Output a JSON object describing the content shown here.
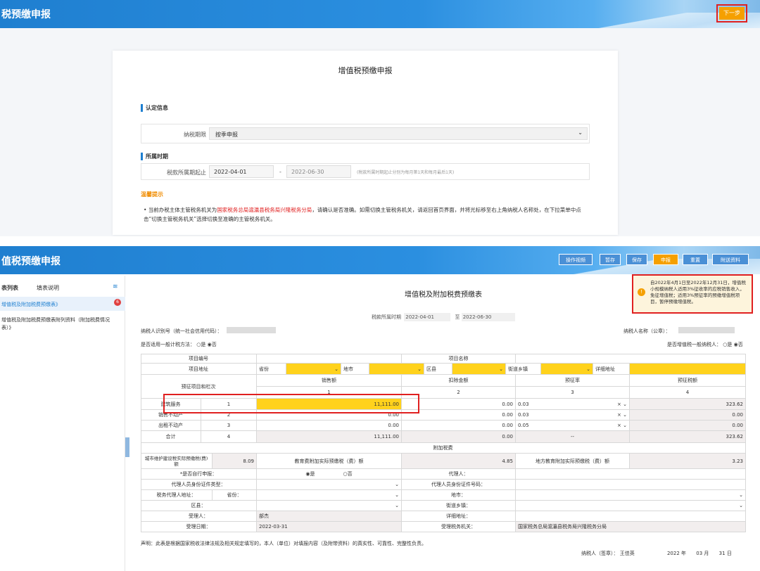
{
  "top": {
    "title": "税预缴申报",
    "next_button": "下一步",
    "card_title": "增值税预缴申报",
    "section1": "认定信息",
    "period_type_label": "纳税期限",
    "period_type_value": "按季申报",
    "section2": "所属时期",
    "period_label": "税款所属期起止",
    "date_from": "2022-04-01",
    "dash": "-",
    "date_to": "2022-06-30",
    "period_hint": "(税款所属时期起止分别为每月第1天和每月最后1天)",
    "tips_title": "温馨提示",
    "tip_pre": "当前办税主体主管税务机关为",
    "tip_red": "国家税务总局滬灜县税务局兴隆税务分局",
    "tip_post": "，请确认是否准确。如需切换主管税务机关，请返回首页界面，并将光标移至右上角纳税人名称处，在下拉菜单中点击“切换主管税务机关”选择切换至准确的主管税务机关。"
  },
  "bottom": {
    "title": "值税预缴申报",
    "buttons": [
      "操作视频",
      "暂存",
      "保存",
      "申报",
      "重置",
      "附送资料"
    ],
    "sidebar": {
      "tab1": "表列表",
      "tab2": "填表说明",
      "item1": "增值税及附加税费预缴表》",
      "item1_badge": "6",
      "item2": "增值税及附加税费预缴表附列资料（附加税费情况表）》"
    },
    "form_title": "增值税及附加税费预缴表",
    "period_label": "税款所属时期",
    "period_from": "2022-04-01",
    "period_to_label": "至",
    "period_to": "2022-06-30",
    "taxpayer_id_label": "纳税人识别号（统一社会信用代码）：",
    "taxpayer_name_label": "纳税人名称（公章）：",
    "general_method_label": "是否适用一般计税方法：",
    "general_yes": "是",
    "general_no": "否",
    "general_taxpayer_label": "是否增值税一般纳税人：",
    "notice": "自2022年4月1日至2022年12月31日，增值税小规模纳税人适用3%征收率的应税销售收入，免征增值税；适用3%预征率的预缴增值税项目，暂停预缴增值税。",
    "project_no": "项目编号",
    "project_name": "项目名称",
    "project_addr": "项目地址",
    "province": "省份",
    "city": "地市",
    "district": "区县",
    "street": "街道乡镇",
    "detail_addr": "详细地址",
    "col_item": "预征项目和栏次",
    "col_sales": "销售额",
    "col_deduct": "扣除金额",
    "col_rate": "预征率",
    "col_tax": "预征税额",
    "col_n1": "1",
    "col_n2": "2",
    "col_n3": "3",
    "col_n4": "4",
    "rows": [
      {
        "name": "建筑服务",
        "no": "1",
        "sales": "11,111.00",
        "deduct": "0.00",
        "rate": "0.03",
        "tax": "323.62"
      },
      {
        "name": "销售不动产",
        "no": "2",
        "sales": "0.00",
        "deduct": "0.00",
        "rate": "0.03",
        "tax": "0.00"
      },
      {
        "name": "出租不动产",
        "no": "3",
        "sales": "0.00",
        "deduct": "0.00",
        "rate": "0.05",
        "tax": "0.00"
      },
      {
        "name": "合计",
        "no": "4",
        "sales": "11,111.00",
        "deduct": "0.00",
        "rate": "--",
        "tax": "323.62"
      }
    ],
    "surtax": "附加税费",
    "city_tax_label": "城市维护建设税实际预缴税(费)额",
    "city_tax": "8.09",
    "edu_label": "教育费附加实际预缴税（费）额",
    "edu": "4.85",
    "local_edu_label": "地方教育附加实际预缴税（费）额",
    "local_edu": "3.23",
    "self_label": "*是否自行申报：",
    "self_yes": "是",
    "self_no": "否",
    "agent_label": "代理人：",
    "agent_id_type": "代理人员身份证件类型：",
    "agent_id_no": "代理人员身份证件号码：",
    "agent_addr": "税务代理人地址：",
    "prov2": "省份：",
    "city2": "地市：",
    "district2": "区县：",
    "street2": "街道乡镇：",
    "handler_label": "受理人：",
    "handler": "部杰",
    "detail2": "详细地址：",
    "date_label": "受理日期：",
    "date": "2022-03-31",
    "office_label": "受理税务机关：",
    "office": "国家税务总局滬灜县税务局兴隆税务分局",
    "statement": "声明：此表是根据国家税收法律法规及相关规定填写的，本人（单位）对填报内容（及附带资料）的真实性、可靠性、完整性负责。",
    "sign_label": "纳税人（签章）：",
    "sign_name": "王佳英",
    "year": "2022",
    "year_l": "年",
    "month": "03",
    "month_l": "月",
    "day": "31",
    "day_l": "日"
  }
}
